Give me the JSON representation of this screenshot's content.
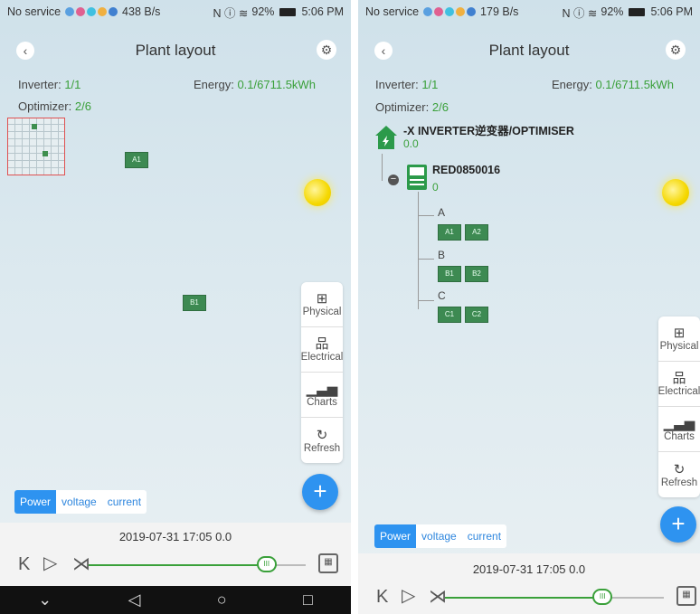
{
  "screen1": {
    "status": {
      "carrier": "No service",
      "speed": "438 B/s",
      "icons": "N ⓘ ≋",
      "battery": "92%",
      "time": "5:06 PM"
    },
    "title": "Plant layout",
    "inverter_label": "Inverter:",
    "inverter_value": "1/1",
    "energy_label": "Energy:",
    "energy_value": "0.1/6711.5kWh",
    "optimizer_label": "Optimizer:",
    "optimizer_value": "2/6",
    "panels": [
      "A1",
      "B1"
    ],
    "side_menu": [
      {
        "icon": "grid-icon",
        "label": "Physical"
      },
      {
        "icon": "hierarchy-icon",
        "label": "Electrical"
      },
      {
        "icon": "bar-chart-icon",
        "label": "Charts"
      },
      {
        "icon": "refresh-icon",
        "label": "Refresh"
      }
    ],
    "tabs": [
      "Power",
      "voltage",
      "current"
    ],
    "active_tab": "Power",
    "timestamp": "2019-07-31 17:05",
    "timestamp_value": "0.0",
    "slider_fraction": 0.82,
    "nav": {
      "back": "◁",
      "home": "○",
      "recent": "□",
      "down": "⌄"
    }
  },
  "screen2": {
    "status": {
      "carrier": "No service",
      "speed": "179 B/s",
      "icons": "N ⓘ ≋",
      "battery": "92%",
      "time": "5:06 PM"
    },
    "title": "Plant layout",
    "inverter_label": "Inverter:",
    "inverter_value": "1/1",
    "energy_label": "Energy:",
    "energy_value": "0.1/6711.5kWh",
    "optimizer_label": "Optimizer:",
    "optimizer_value": "2/6",
    "site_name": "-X INVERTER逆变器/OPTIMISER",
    "site_value": "0.0",
    "inverter_name": "RED0850016",
    "inverter_power": "0",
    "groups": [
      {
        "label": "A",
        "panels": [
          "A1",
          "A2"
        ]
      },
      {
        "label": "B",
        "panels": [
          "B1",
          "B2"
        ]
      },
      {
        "label": "C",
        "panels": [
          "C1",
          "C2"
        ]
      }
    ],
    "side_menu": [
      {
        "icon": "grid-icon",
        "label": "Physical"
      },
      {
        "icon": "hierarchy-icon",
        "label": "Electrical"
      },
      {
        "icon": "bar-chart-icon",
        "label": "Charts"
      },
      {
        "icon": "refresh-icon",
        "label": "Refresh"
      }
    ],
    "tabs": [
      "Power",
      "voltage",
      "current"
    ],
    "active_tab": "Power",
    "timestamp": "2019-07-31 17:05",
    "timestamp_value": "0.0",
    "slider_fraction": 0.72
  },
  "colors": {
    "accent": "#2e93f0",
    "value_green": "#3aa03a",
    "panel": "#3d8a52"
  }
}
